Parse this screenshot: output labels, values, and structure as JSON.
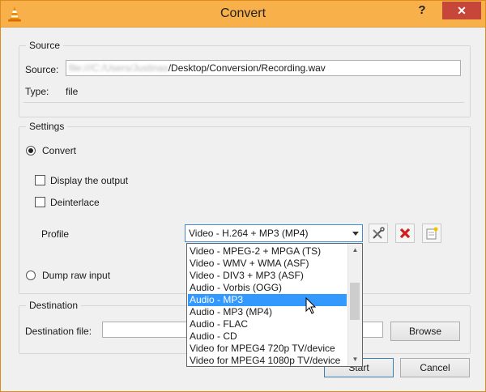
{
  "window": {
    "title": "Convert",
    "help_label": "?",
    "close_label": "✕",
    "app_icon": "vlc-cone-icon"
  },
  "source": {
    "group_title": "Source",
    "source_label": "Source:",
    "source_value_blurred": "file:///C:/Users/Justinas",
    "source_value": "/Desktop/Conversion/Recording.wav",
    "type_label": "Type:",
    "type_value": "file"
  },
  "settings": {
    "group_title": "Settings",
    "convert_label": "Convert",
    "convert_checked": true,
    "display_output_label": "Display the output",
    "display_output_checked": false,
    "deinterlace_label": "Deinterlace",
    "deinterlace_checked": false,
    "profile_label": "Profile",
    "profile_selected": "Video - H.264 + MP3 (MP4)",
    "dump_raw_label": "Dump raw input",
    "dump_raw_checked": false,
    "profile_tools": [
      "edit-profile-icon",
      "delete-profile-icon",
      "new-profile-icon"
    ]
  },
  "profile_dropdown": {
    "items": [
      "Video - MPEG-2 + MPGA (TS)",
      "Video - WMV + WMA (ASF)",
      "Video - DIV3 + MP3 (ASF)",
      "Audio - Vorbis (OGG)",
      "Audio - MP3",
      "Audio - MP3 (MP4)",
      "Audio - FLAC",
      "Audio - CD",
      "Video for MPEG4 720p TV/device",
      "Video for MPEG4 1080p TV/device"
    ],
    "highlighted_index": 4,
    "highlight_color": "#3399ff"
  },
  "destination": {
    "group_title": "Destination",
    "file_label": "Destination file:",
    "file_value": "",
    "browse_label": "Browse"
  },
  "footer": {
    "start_label": "Start",
    "cancel_label": "Cancel"
  }
}
